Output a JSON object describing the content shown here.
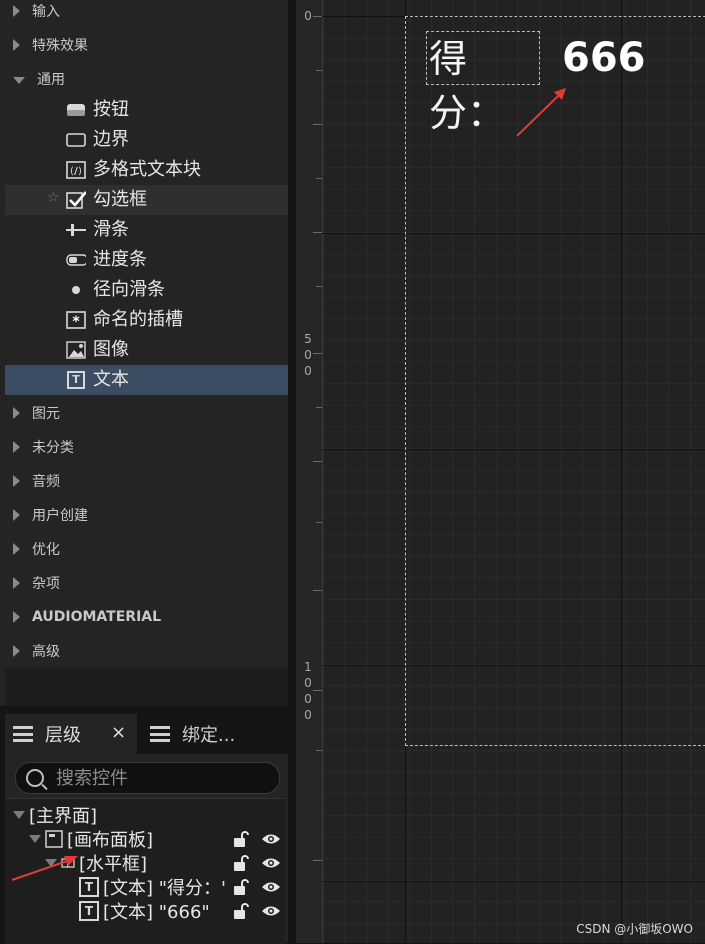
{
  "palette": {
    "categories_top": [
      {
        "label": "输入",
        "expanded": false
      },
      {
        "label": "特殊效果",
        "expanded": false
      },
      {
        "label": "通用",
        "expanded": true
      }
    ],
    "items": [
      {
        "label": "按钮",
        "icon": "button-icon"
      },
      {
        "label": "边界",
        "icon": "border-icon"
      },
      {
        "label": "多格式文本块",
        "icon": "rich-text-icon"
      },
      {
        "label": "勾选框",
        "icon": "checkbox-icon",
        "favorite": true
      },
      {
        "label": "滑条",
        "icon": "slider-icon"
      },
      {
        "label": "进度条",
        "icon": "progress-bar-icon"
      },
      {
        "label": "径向滑条",
        "icon": "radial-slider-icon"
      },
      {
        "label": "命名的插槽",
        "icon": "named-slot-icon"
      },
      {
        "label": "图像",
        "icon": "image-icon"
      },
      {
        "label": "文本",
        "icon": "text-icon",
        "selected": true
      }
    ],
    "categories_bottom": [
      {
        "label": "图元"
      },
      {
        "label": "未分类"
      },
      {
        "label": "音频"
      },
      {
        "label": "用户创建"
      },
      {
        "label": "优化"
      },
      {
        "label": "杂项"
      },
      {
        "label": "AUDIOMATERIAL"
      },
      {
        "label": "高级"
      }
    ]
  },
  "tabs": {
    "hierarchy": "层级",
    "close": "×",
    "bindings": "绑定..."
  },
  "hierarchy": {
    "search_placeholder": "搜索控件",
    "tree": [
      {
        "label": "[主界面]"
      },
      {
        "label": "[画布面板]"
      },
      {
        "label": "[水平框]"
      },
      {
        "label": "[文本] \"得分：'"
      },
      {
        "label": "[文本] \"666\""
      }
    ]
  },
  "canvas": {
    "ruler_labels": [
      "0",
      "5\n0\n0",
      "1\n0\n0\n0"
    ],
    "text_widget_1": "得分：",
    "text_widget_2": "666",
    "colors": {
      "annotation_arrow": "#e23a3a",
      "selection": "#3c4d63"
    }
  },
  "watermark": "CSDN @小御坂OWO"
}
